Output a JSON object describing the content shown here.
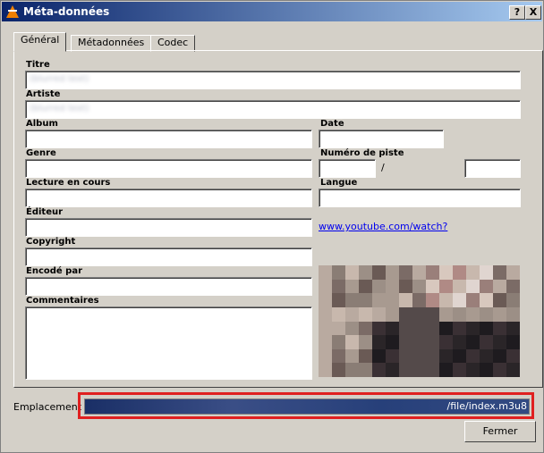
{
  "window": {
    "title": "Méta-données",
    "help_label": "?",
    "close_label": "X"
  },
  "tabs": [
    {
      "label": "Général"
    },
    {
      "label": "Métadonnées"
    },
    {
      "label": "Codec"
    }
  ],
  "fields": {
    "titre": {
      "label": "Titre",
      "value": "(blurred text)"
    },
    "artiste": {
      "label": "Artiste",
      "value": "(blurred text)"
    },
    "album": {
      "label": "Album",
      "value": ""
    },
    "date": {
      "label": "Date",
      "value": ""
    },
    "genre": {
      "label": "Genre",
      "value": ""
    },
    "numero_piste": {
      "label": "Numéro de piste",
      "value": "",
      "total": "",
      "separator": "/"
    },
    "lecture_en_cours": {
      "label": "Lecture en cours",
      "value": ""
    },
    "langue": {
      "label": "Langue",
      "value": ""
    },
    "editeur": {
      "label": "Éditeur",
      "value": ""
    },
    "copyright": {
      "label": "Copyright",
      "value": ""
    },
    "encode_par": {
      "label": "Encodé par",
      "value": ""
    },
    "commentaires": {
      "label": "Commentaires",
      "value": ""
    }
  },
  "url_link": "www.youtube.com/watch?",
  "emplacement": {
    "label": "Emplacement :",
    "value": "/file/index.m3u8"
  },
  "close_button": {
    "label": "Fermer"
  },
  "colors": {
    "highlight_border": "#e02020",
    "titlebar_start": "#0a246a",
    "titlebar_end": "#a6caf0",
    "link": "#0000ee"
  }
}
